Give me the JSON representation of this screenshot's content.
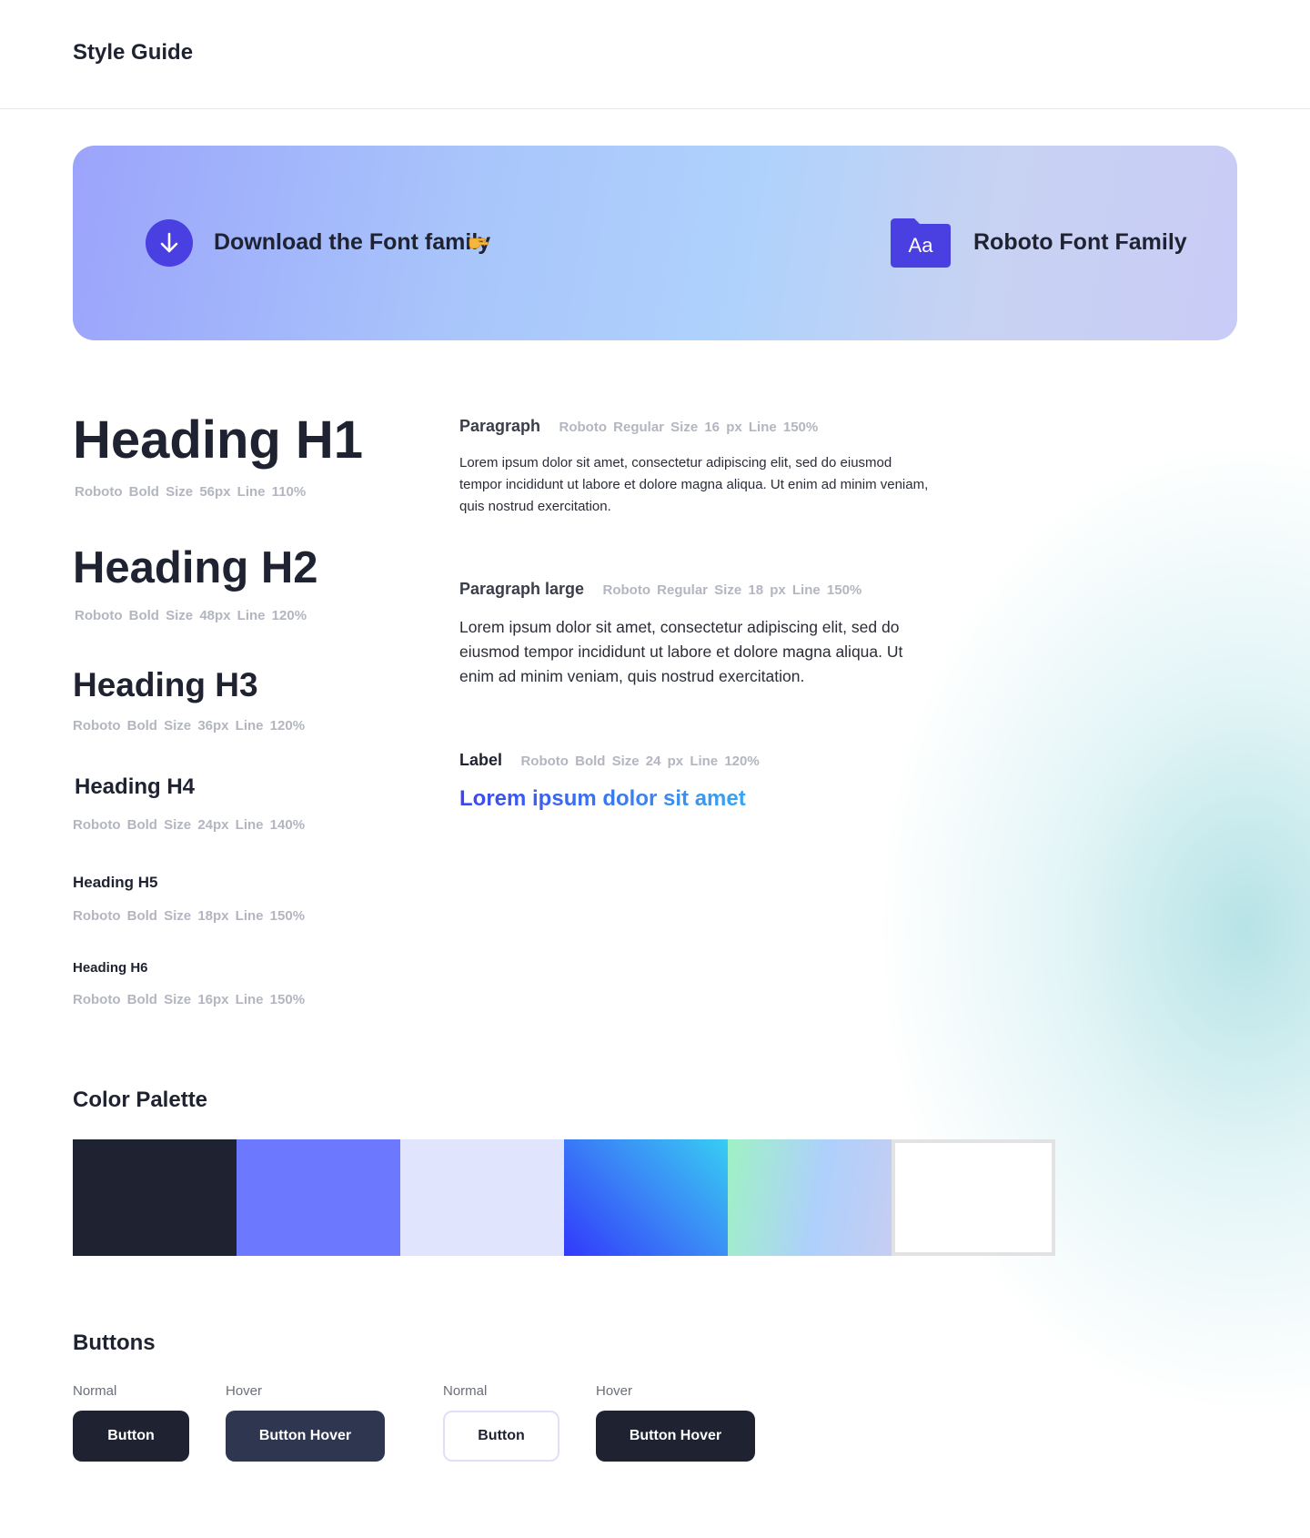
{
  "header": {
    "title": "Style Guide"
  },
  "banner": {
    "download_label": "Download the Font family",
    "font_icon_text": "Aa",
    "font_family_label": "Roboto Font Family"
  },
  "headings": {
    "h1": {
      "text": "Heading H1",
      "meta": "Roboto Bold  Size 56px  Line 110%"
    },
    "h2": {
      "text": "Heading H2",
      "meta": "Roboto  Bold Size 48px  Line 120%"
    },
    "h3": {
      "text": "Heading H3",
      "meta": "Roboto  Bold Size 36px  Line 120%"
    },
    "h4": {
      "text": "Heading H4",
      "meta": "Roboto  Bold Size 24px  Line 140%"
    },
    "h5": {
      "text": "Heading H5",
      "meta": "Roboto  Bold Size 18px  Line 150%"
    },
    "h6": {
      "text": "Heading H6",
      "meta": "Roboto Bold Size 16px  Line 150%"
    }
  },
  "text_styles": {
    "paragraph": {
      "name": "Paragraph",
      "spec": "Roboto Regular Size 16 px  Line 150%",
      "sample": "Lorem ipsum dolor sit amet, consectetur adipiscing elit, sed do eiusmod tempor incididunt ut labore et dolore magna aliqua. Ut enim ad minim veniam, quis nostrud exercitation."
    },
    "paragraph_large": {
      "name": "Paragraph large",
      "spec": "Roboto Regular  Size 18 px  Line 150%",
      "sample": "Lorem ipsum dolor sit amet, consectetur adipiscing elit, sed do eiusmod tempor incididunt ut labore et dolore magna aliqua. Ut enim ad minim veniam, quis nostrud exercitation."
    },
    "label": {
      "name": "Label",
      "spec": "Roboto Bold  Size 24 px  Line 120%",
      "sample": "Lorem ipsum dolor sit amet"
    }
  },
  "palette": {
    "title": "Color Palette",
    "colors": [
      "#1f2231",
      "#6c78fd",
      "#e0e4fc",
      "gradient: #3139fb → #38cdf3",
      "gradient: #9ff2c4 → #aed0fc → #c6cdf1",
      "#ffffff"
    ]
  },
  "buttons": {
    "title": "Buttons",
    "items": [
      {
        "state": "Normal",
        "label": "Button"
      },
      {
        "state": "Hover",
        "label": "Button Hover"
      },
      {
        "state": "Normal",
        "label": "Button"
      },
      {
        "state": "Hover",
        "label": "Button Hover"
      }
    ]
  },
  "icons": {
    "download": "arrow-down-circle-icon",
    "pointing": "pointing-hand-icon",
    "folder": "font-folder-icon"
  }
}
